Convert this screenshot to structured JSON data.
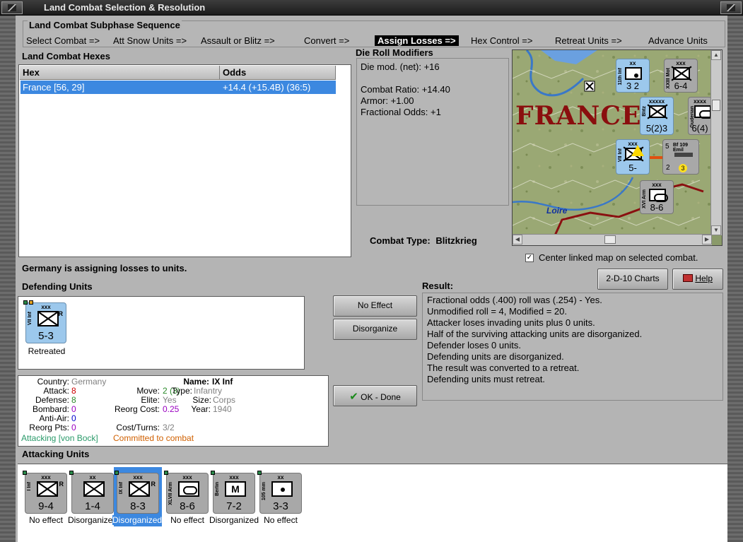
{
  "window": {
    "title": "Land Combat Selection & Resolution"
  },
  "subphase": {
    "title": "Land Combat Subphase Sequence",
    "steps": [
      {
        "label": "Select Combat =>",
        "active": false
      },
      {
        "label": "Att Snow Units =>",
        "active": false
      },
      {
        "label": "Assault or Blitz =>",
        "active": false
      },
      {
        "label": "Convert =>",
        "active": false
      },
      {
        "label": "Assign Losses =>",
        "active": true
      },
      {
        "label": "Hex Control =>",
        "active": false
      },
      {
        "label": "Retreat Units =>",
        "active": false
      },
      {
        "label": "Advance Units",
        "active": false
      }
    ]
  },
  "hexes": {
    "title": "Land Combat Hexes",
    "headers": [
      "Hex",
      "Odds"
    ],
    "rows": [
      {
        "hex": "France [56, 29]",
        "odds": "+14.4 (+15.4B) (36:5)"
      }
    ]
  },
  "die_roll": {
    "title": "Die Roll Modifiers",
    "lines": [
      "Die mod. (net): +16",
      "",
      "Combat Ratio: +14.40",
      "Armor: +1.00",
      "Fractional Odds: +1"
    ]
  },
  "combat_type": {
    "label": "Combat Type:",
    "value": "Blitzkrieg"
  },
  "map": {
    "country_label": "FRANCE",
    "river_label": "Loire",
    "center_checkbox": {
      "label": "Center linked map on selected combat.",
      "checked": true
    },
    "counters": [
      {
        "unit": "11th Inf",
        "size": "xx",
        "str": "3 2",
        "type": "art",
        "gray": false
      },
      {
        "unit": "XXIII Mot",
        "size": "xxx",
        "str": "6-4",
        "type": "inf",
        "gray": true
      },
      {
        "unit": "Blitz",
        "size": "xxxxx",
        "str": "5(2)3",
        "type": "inf",
        "gray": false
      },
      {
        "unit": "Guderian",
        "size": "xxxx",
        "str": "6(4)",
        "type": "arm",
        "gray": true
      },
      {
        "unit": "VII Inf",
        "size": "xxx",
        "str": "5-",
        "type": "inf",
        "gray": false
      },
      {
        "unit": "XVI Arm",
        "size": "xxx",
        "str": "8-6",
        "type": "arm",
        "gray": true
      }
    ],
    "air": {
      "name": "Bf 109 Emil",
      "nums": [
        "5",
        "2",
        "3"
      ]
    }
  },
  "status": "Germany is assigning losses to units.",
  "buttons": {
    "charts": "2-D-10 Charts",
    "help": "Help",
    "no_effect": "No Effect",
    "disorganize": "Disorganize",
    "ok": "OK - Done"
  },
  "defending": {
    "title": "Defending Units",
    "units": [
      {
        "unit": "VII Inf",
        "size": "xxx",
        "str": "5-3",
        "type": "inf",
        "mark": "R",
        "status": "Retreated"
      }
    ]
  },
  "result": {
    "title": "Result:",
    "lines": [
      "Fractional odds (.400) roll was (.254)  - Yes.",
      "Unmodified roll = 4, Modified = 20.",
      "Attacker loses invading units plus 0 units.",
      "Half of the surviving attacking units are disorganized.",
      "Defender loses 0 units.",
      "Defending units are disorganized.",
      "The result was converted to a retreat.",
      "Defending units must retreat."
    ]
  },
  "info": {
    "country_l": "Country:",
    "country_v": "Germany",
    "attack_l": "Attack:",
    "attack_v": "8",
    "defense_l": "Defense:",
    "defense_v": "8",
    "bombard_l": "Bombard:",
    "bombard_v": "0",
    "antiair_l": "Anti-Air:",
    "antiair_v": "0",
    "reorg_l": "Reorg Pts:",
    "reorg_v": "0",
    "name_l": "Name:",
    "name_v": "IX Inf",
    "move_l": "Move:",
    "move_v": "2 (3)",
    "type_l": "Type:",
    "type_v": "Infantry",
    "elite_l": "Elite:",
    "elite_v": "Yes",
    "size_l": "Size:",
    "size_v": "Corps",
    "rcost_l": "Reorg Cost:",
    "rcost_v": "0.25",
    "year_l": "Year:",
    "year_v": "1940",
    "cost_l": "Cost/Turns:",
    "cost_v": "3/2",
    "attacking_v": "Attacking [von Bock]",
    "committed_v": "Committed to combat",
    "colors": {
      "red": "#cc0000",
      "green": "#2a8a2a",
      "purple": "#9a00c0",
      "blue": "#0000cc",
      "gray": "#808080",
      "orange": "#d06000",
      "teal": "#2a9a6a"
    }
  },
  "attacking": {
    "title": "Attacking Units",
    "units": [
      {
        "unit": "I Inf",
        "size": "xxx",
        "str": "9-4",
        "type": "inf",
        "mark": "R",
        "status": "No effect",
        "selected": false
      },
      {
        "unit": "",
        "size": "xx",
        "str": "1-4",
        "type": "inf",
        "mark": "",
        "status": "Disorganized",
        "selected": false
      },
      {
        "unit": "IX Inf",
        "size": "xxx",
        "str": "8-3",
        "type": "inf",
        "mark": "R",
        "status": "Disorganized",
        "selected": true
      },
      {
        "unit": "XLVII Arm",
        "size": "xxx",
        "str": "8-6",
        "type": "arm",
        "mark": "",
        "status": "No effect",
        "selected": false
      },
      {
        "unit": "Berlin",
        "size": "xxx",
        "str": "7-2",
        "type": "mtn",
        "mark": "",
        "status": "Disorganized",
        "selected": false
      },
      {
        "unit": "105 mm",
        "size": "xx",
        "str": "3-3",
        "type": "art",
        "mark": "",
        "status": "No effect",
        "selected": false
      }
    ]
  }
}
